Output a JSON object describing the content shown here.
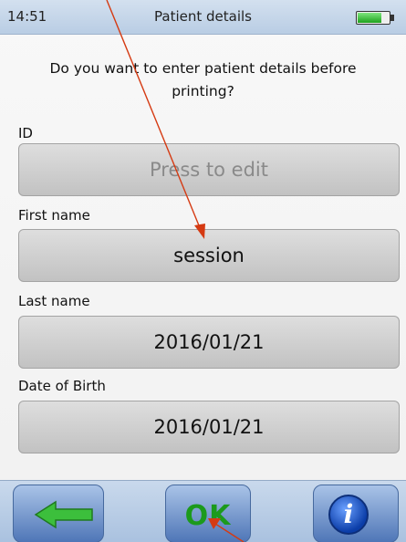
{
  "status_bar": {
    "time": "14:51",
    "title": "Patient details",
    "battery_level": 0.8,
    "battery_icon": "battery-icon"
  },
  "prompt": "Do you want to enter patient details before printing?",
  "fields": [
    {
      "label": "ID",
      "value": "Press to edit",
      "is_placeholder": true
    },
    {
      "label": "First name",
      "value": "session",
      "is_placeholder": false
    },
    {
      "label": "Last name",
      "value": "2016/01/21",
      "is_placeholder": false
    },
    {
      "label": "Date of Birth",
      "value": "2016/01/21",
      "is_placeholder": false
    }
  ],
  "bottom_bar": {
    "back_icon": "back-arrow-icon",
    "ok_label": "OK",
    "info_label": "i",
    "info_icon": "info-icon"
  },
  "annotations": {
    "arrow_color": "#d53a12",
    "arrow_icon": "annotation-arrow-icon"
  }
}
